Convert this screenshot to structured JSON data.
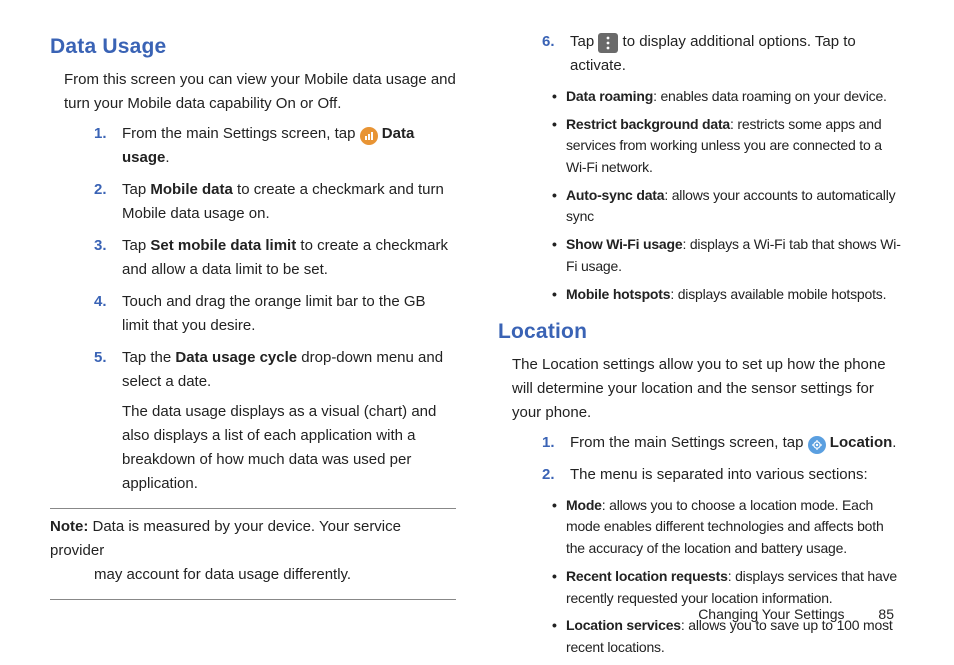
{
  "left": {
    "heading": "Data Usage",
    "intro": "From this screen you can view your Mobile data usage and turn your Mobile data capability On or Off.",
    "steps": {
      "s1a": "From the main Settings screen, tap ",
      "s1b": "Data usage",
      "s1c": ".",
      "s2a": "Tap ",
      "s2b": "Mobile data",
      "s2c": " to create a checkmark and turn Mobile data usage on.",
      "s3a": "Tap ",
      "s3b": "Set mobile data limit",
      "s3c": " to create a checkmark and allow a data limit to be set.",
      "s4": "Touch and drag the orange limit bar to the GB limit that you desire.",
      "s5a": "Tap the ",
      "s5b": "Data usage cycle",
      "s5c": " drop-down menu and select a date.",
      "s5d": "The data usage displays as a visual (chart) and also displays a list of each application with a breakdown of how much data was used per application."
    },
    "note_label": "Note:",
    "note_first": " Data is measured by your device. Your service provider",
    "note_rest": "may account for data usage differently."
  },
  "right": {
    "step6a": "Tap ",
    "step6b": " to display additional options. Tap to activate.",
    "bullets6": {
      "b1a": "Data roaming",
      "b1b": ": enables data roaming on your device.",
      "b2a": "Restrict background data",
      "b2b": ": restricts some apps and services from working unless you are connected to a Wi-Fi network.",
      "b3a": "Auto-sync data",
      "b3b": ": allows your accounts to automatically sync",
      "b4a": "Show Wi-Fi usage",
      "b4b": ": displays a Wi-Fi tab that shows Wi-Fi usage.",
      "b5a": "Mobile hotspots",
      "b5b": ": displays available mobile hotspots."
    },
    "loc_heading": "Location",
    "loc_intro": "The Location settings allow you to set up how the phone will determine your location and the sensor settings for your phone.",
    "loc_steps": {
      "s1a": "From the main Settings screen, tap ",
      "s1b": "Location",
      "s1c": ".",
      "s2": "The menu is separated into various sections:"
    },
    "loc_bullets": {
      "b1a": "Mode",
      "b1b": ": allows you to choose a location mode. Each mode enables different technologies and affects both the accuracy of the location and battery usage.",
      "b2a": "Recent location requests",
      "b2b": ": displays services that have recently requested your location information.",
      "b3a": "Location services",
      "b3b": ": allows you to save up to 100 most recent locations."
    }
  },
  "footer": {
    "chapter": "Changing Your Settings",
    "page": "85"
  }
}
